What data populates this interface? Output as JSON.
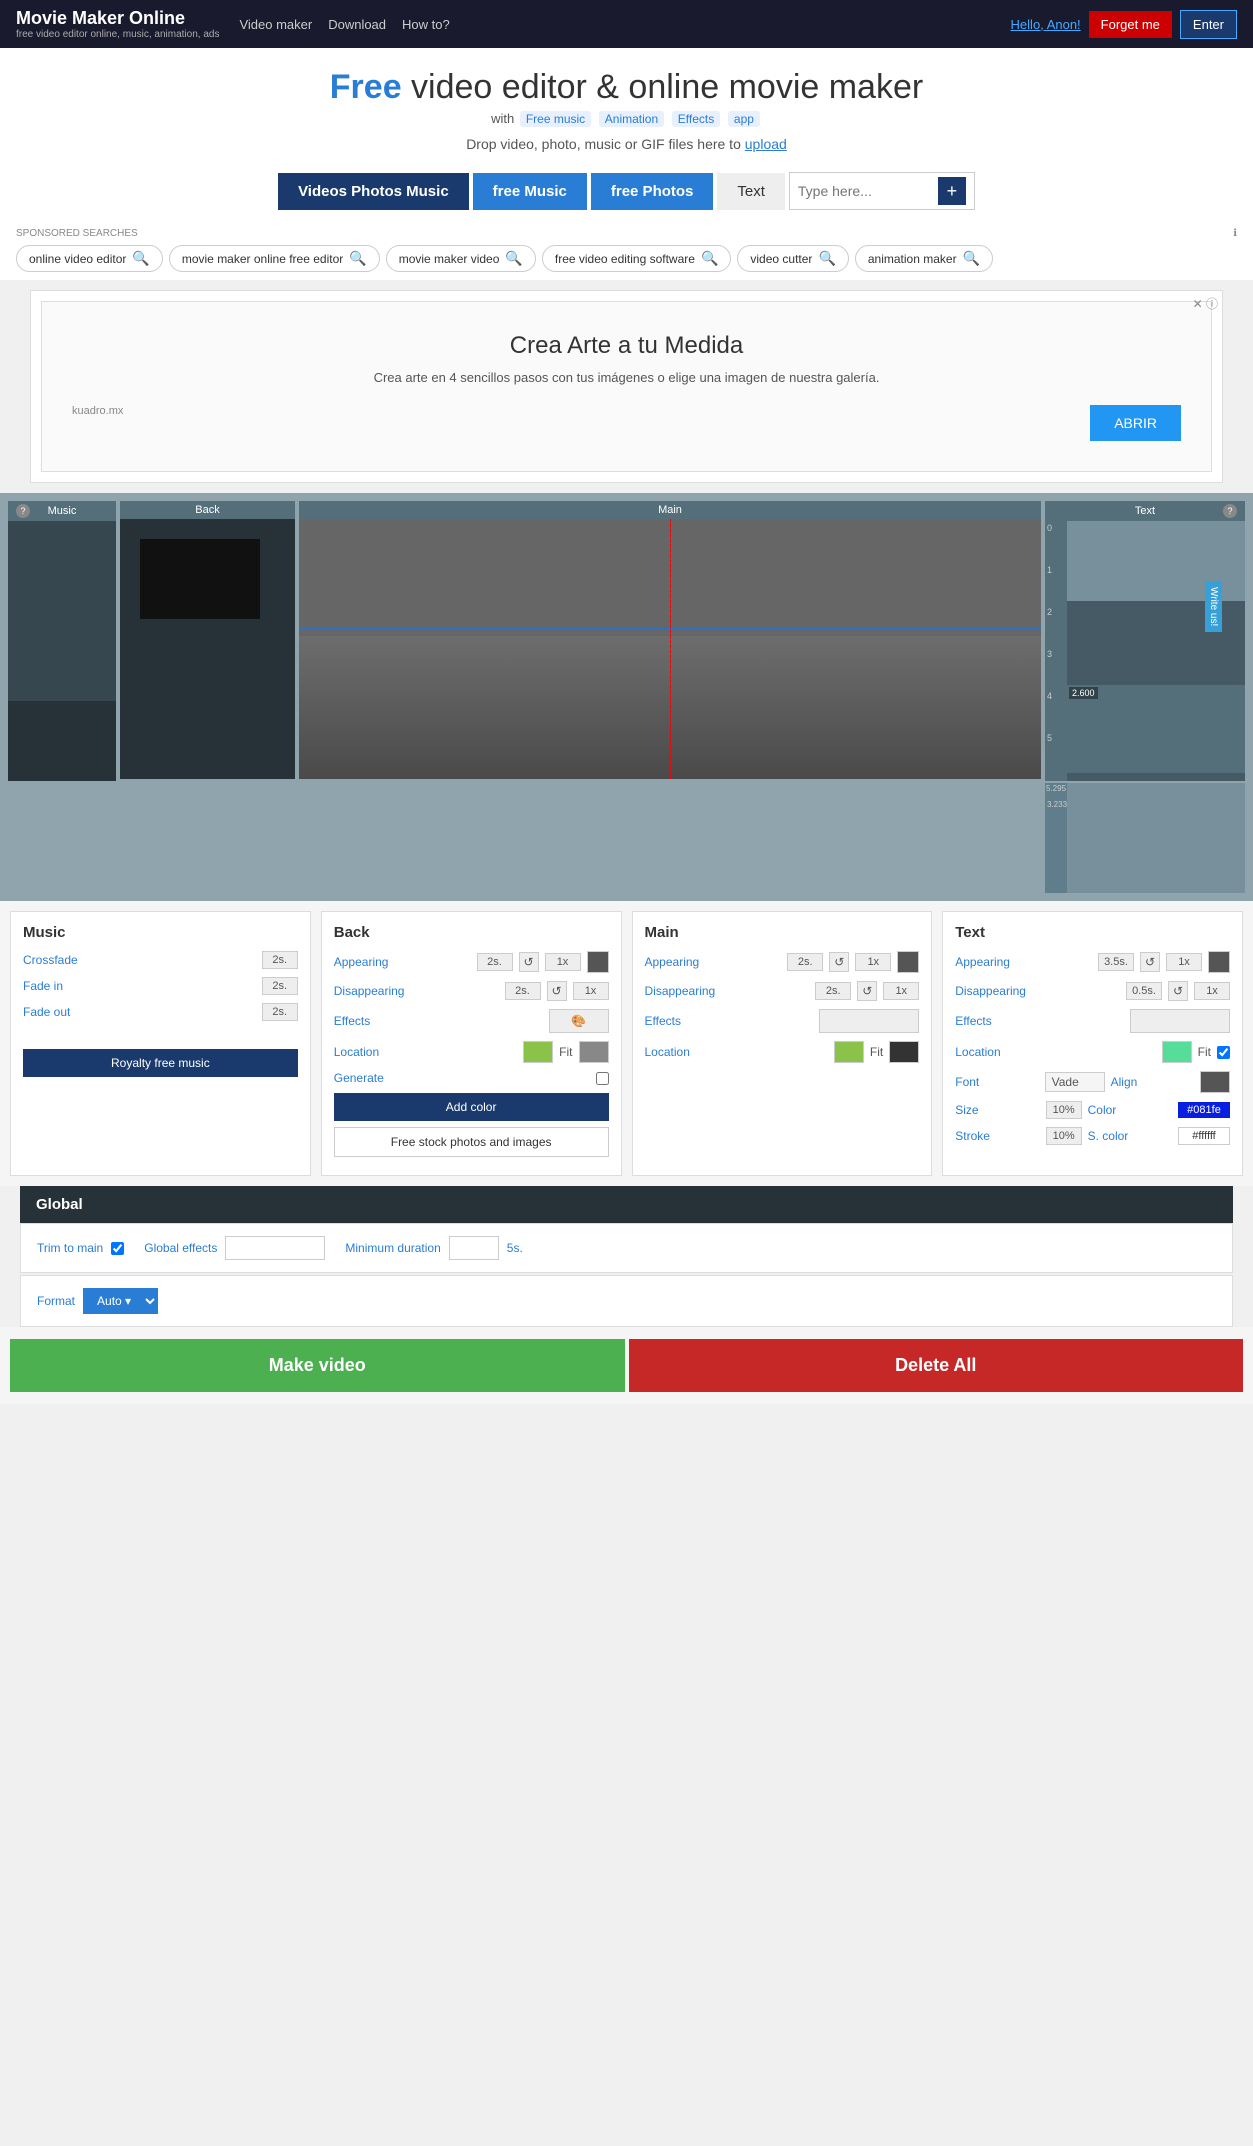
{
  "header": {
    "logo": "Movie Maker Online",
    "logo_sub": "free video editor online, music, animation, ads",
    "nav": [
      "Video maker",
      "Download",
      "How to?"
    ],
    "hello": "Hello, ",
    "user": "Anon!",
    "forget_label": "Forget me",
    "enter_label": "Enter"
  },
  "hero": {
    "title_free": "Free",
    "title_rest": " video editor & online movie maker",
    "with_label": "with",
    "pills": [
      "Free music",
      "Animation",
      "Effects",
      "app"
    ],
    "drop_text": "Drop video, photo, music or GIF files here to",
    "upload_label": "upload"
  },
  "tabs": {
    "videos_label": "Videos Photos Music",
    "music_label": "free Music",
    "photos_label": "free Photos",
    "text_label": "Text",
    "search_placeholder": "Type here...",
    "add_label": "+"
  },
  "sponsored": {
    "label": "SPONSORED SEARCHES",
    "info": "ℹ",
    "pills": [
      "online video editor",
      "movie maker online free editor",
      "movie maker video",
      "free video editing software",
      "video cutter",
      "animation maker"
    ]
  },
  "ad": {
    "title": "Crea Arte a tu Medida",
    "desc": "Crea arte en 4 sencillos pasos con tus imágenes o elige una imagen de nuestra galería.",
    "source": "kuadro.mx",
    "btn_label": "ABRIR",
    "close_label": "✕ ⓘ"
  },
  "editor": {
    "sections": [
      "Music",
      "Back",
      "Main",
      "Text"
    ],
    "write_us": "Write us!",
    "timeline_numbers": [
      "0",
      "1",
      "2",
      "3",
      "4",
      "5",
      "5.295",
      "3.233"
    ]
  },
  "controls": {
    "music": {
      "title": "Music",
      "crossfade_label": "Crossfade",
      "crossfade_val": "2s.",
      "fade_in_label": "Fade in",
      "fade_in_val": "2s.",
      "fade_out_label": "Fade out",
      "fade_out_val": "2s.",
      "royalty_label": "Royalty free music"
    },
    "back": {
      "title": "Back",
      "appearing_label": "Appearing",
      "appearing_val": "2s.",
      "disappearing_label": "Disappearing",
      "disappearing_val": "2s.",
      "effects_label": "Effects",
      "location_label": "Location",
      "fit_label": "Fit",
      "generate_label": "Generate",
      "add_color_label": "Add color",
      "stock_photos_label": "Free stock photos and images"
    },
    "main": {
      "title": "Main",
      "appearing_label": "Appearing",
      "appearing_val": "2s.",
      "disappearing_label": "Disappearing",
      "disappearing_val": "2s.",
      "effects_label": "Effects",
      "location_label": "Location",
      "fit_label": "Fit",
      "multiplier_1x": "1x"
    },
    "text": {
      "title": "Text",
      "appearing_label": "Appearing",
      "appearing_val": "3.5s.",
      "disappearing_label": "Disappearing",
      "disappearing_val": "0.5s.",
      "effects_label": "Effects",
      "location_label": "Location",
      "fit_label": "Fit",
      "font_label": "Font",
      "font_name": "Vade",
      "align_label": "Align",
      "size_label": "Size",
      "size_val": "10%",
      "color_label": "Color",
      "color_val": "#081fe",
      "stroke_label": "Stroke",
      "stroke_val": "10%",
      "s_color_label": "S. color",
      "s_color_val": "#ffffff",
      "multiplier_1x": "1x"
    }
  },
  "global": {
    "title": "Global",
    "trim_label": "Trim to main",
    "effects_label": "Global effects",
    "effects_placeholder": "",
    "min_duration_label": "Minimum duration",
    "min_duration_val": "5s.",
    "format_label": "Format",
    "format_val": "Auto"
  },
  "actions": {
    "make_label": "Make video",
    "delete_label": "Delete All"
  }
}
